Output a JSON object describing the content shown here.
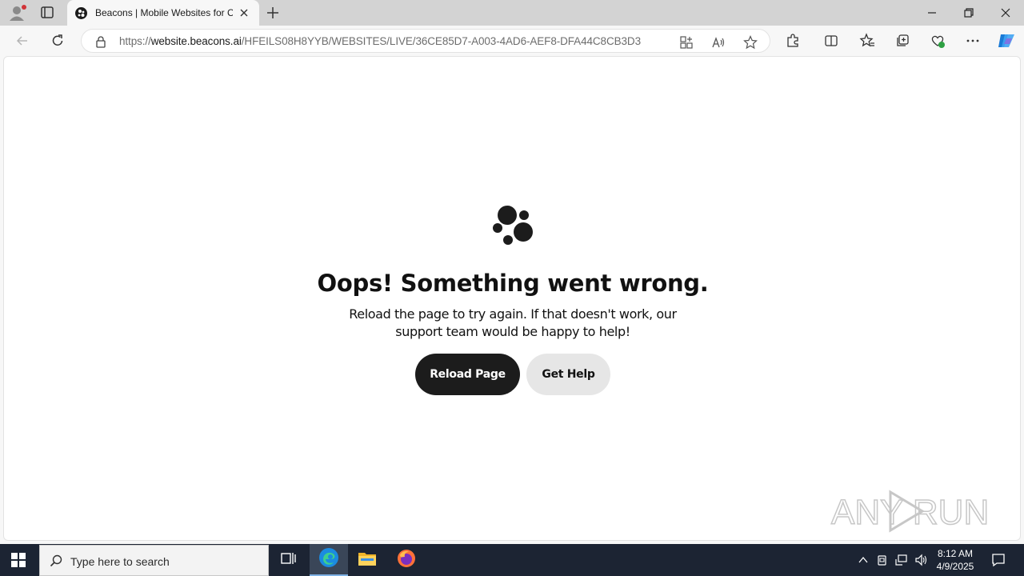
{
  "browser": {
    "tab": {
      "title": "Beacons | Mobile Websites for Cr",
      "close_label": "×"
    },
    "address": {
      "scheme": "https://",
      "host": "website.beacons.ai",
      "path": "/HFEILS08H8YYB/WEBSITES/LIVE/36CE85D7-A003-4AD6-AEF8-DFA44C8CB3D3"
    }
  },
  "page": {
    "headline": "Oops! Something went wrong.",
    "subtext": "Reload the page to try again. If that doesn't work, our support team would be happy to help!",
    "reload_button": "Reload Page",
    "help_button": "Get Help",
    "watermark": "ANY RUN"
  },
  "taskbar": {
    "search_placeholder": "Type here to search",
    "time": "8:12 AM",
    "date": "4/9/2025"
  },
  "colors": {
    "accent_dark": "#1c1c1c",
    "secondary_button": "#e6e6e6",
    "taskbar": "#1c2433"
  },
  "icons": [
    "profile-icon",
    "tab-actions-icon",
    "beacons-favicon",
    "close-icon",
    "new-tab-icon",
    "minimize-icon",
    "restore-icon",
    "window-close-icon",
    "back-icon",
    "refresh-icon",
    "lock-icon",
    "app-available-icon",
    "read-aloud-icon",
    "favorite-star-icon",
    "extensions-icon",
    "split-screen-icon",
    "favorites-icon",
    "collections-icon",
    "browser-essentials-icon",
    "more-icon",
    "copilot-icon",
    "windows-start-icon",
    "search-icon",
    "task-view-icon",
    "edge-icon",
    "file-explorer-icon",
    "firefox-icon",
    "chevron-up-icon",
    "meet-now-icon",
    "network-icon",
    "volume-icon",
    "notification-icon"
  ]
}
